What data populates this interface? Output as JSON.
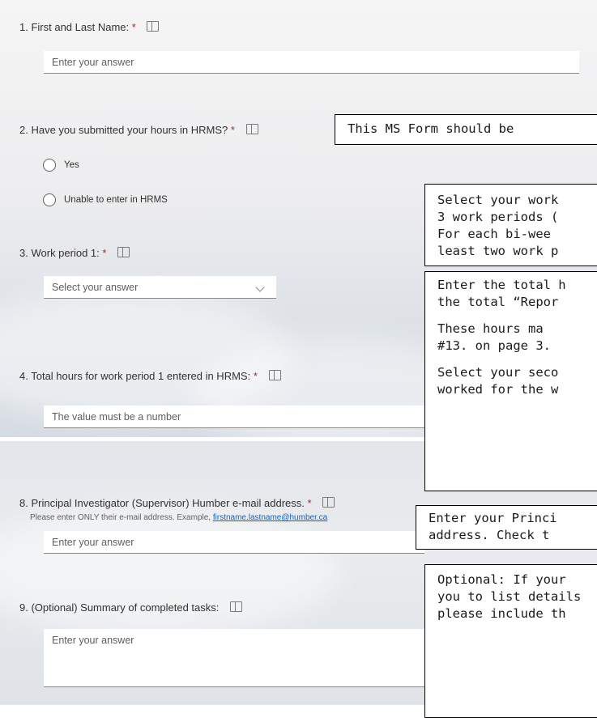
{
  "q1": {
    "number": "1.",
    "label": "First and Last Name:",
    "required": "*",
    "placeholder": "Enter your answer"
  },
  "q2": {
    "number": "2.",
    "label": "Have you submitted your hours in HRMS?",
    "required": "*",
    "options": [
      "Yes",
      "Unable to enter in HRMS"
    ]
  },
  "q3": {
    "number": "3.",
    "label": "Work period 1:",
    "required": "*",
    "placeholder": "Select your answer"
  },
  "q4": {
    "number": "4.",
    "label": "Total hours for work period 1 entered in HRMS:",
    "required": "*",
    "placeholder": "The value must be a number"
  },
  "q8": {
    "number": "8.",
    "label": "Principal Investigator (Supervisor) Humber e-mail address.",
    "required": "*",
    "subtitle_prefix": "Please enter ONLY their e-mail address. Example, ",
    "subtitle_link": "firstname.lastname@humber.ca",
    "placeholder": "Enter your answer"
  },
  "q9": {
    "number": "9.",
    "label": "(Optional) Summary of completed tasks:",
    "placeholder": "Enter your answer"
  },
  "notes": {
    "n1": [
      "This MS Form should be"
    ],
    "n2": [
      "Select your work",
      "3 work periods (",
      "For each bi-wee",
      "least two work p"
    ],
    "n3a": [
      "Enter the total h",
      "the total “Repor"
    ],
    "n3b": [
      "These hours ma",
      "#13. on page 3."
    ],
    "n3c": [
      "Select your seco",
      "worked for the w"
    ],
    "n4": [
      "Enter your Princi",
      "address. Check t"
    ],
    "n5": [
      "Optional: If your",
      "you to list details",
      "please include th"
    ]
  },
  "colors": {
    "required": "#a4262c",
    "link": "#0a62c7",
    "note_border": "#000000"
  },
  "icons": {
    "immersive_reader": "immersive-reader-icon",
    "dropdown": "chevron-down-icon",
    "radio": "radio-icon"
  }
}
